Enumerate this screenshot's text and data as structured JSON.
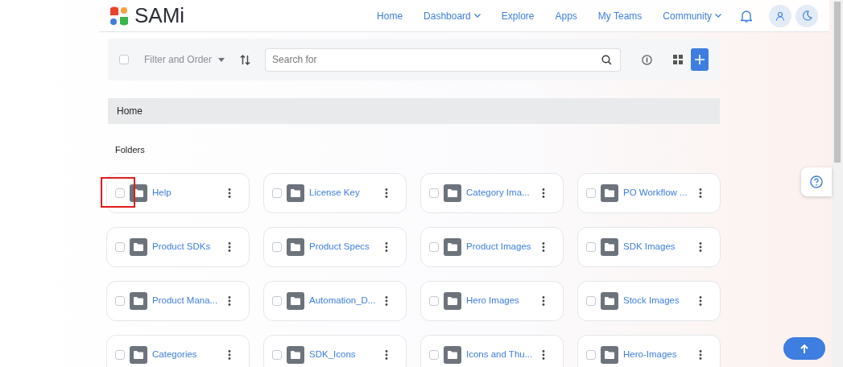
{
  "brand": {
    "name": "SAMi"
  },
  "nav": [
    {
      "label": "Home",
      "dropdown": false
    },
    {
      "label": "Dashboard",
      "dropdown": true
    },
    {
      "label": "Explore",
      "dropdown": false
    },
    {
      "label": "Apps",
      "dropdown": false
    },
    {
      "label": "My Teams",
      "dropdown": false
    },
    {
      "label": "Community",
      "dropdown": true
    }
  ],
  "toolbar": {
    "select_all_checked": false,
    "filter_label": "Filter and Order",
    "search": {
      "placeholder": "Search for"
    }
  },
  "breadcrumb": "Home",
  "section_title": "Folders",
  "folders": [
    {
      "name": "Help",
      "checked": false,
      "highlighted": true
    },
    {
      "name": "License Key",
      "checked": false,
      "highlighted": false
    },
    {
      "name": "Category Ima...",
      "checked": false,
      "highlighted": false
    },
    {
      "name": "PO Workflow ...",
      "checked": false,
      "highlighted": false
    },
    {
      "name": "Product SDKs",
      "checked": false,
      "highlighted": false
    },
    {
      "name": "Product Specs",
      "checked": false,
      "highlighted": false
    },
    {
      "name": "Product Images",
      "checked": false,
      "highlighted": false
    },
    {
      "name": "SDK Images",
      "checked": false,
      "highlighted": false
    },
    {
      "name": "Product Mana...",
      "checked": false,
      "highlighted": false
    },
    {
      "name": "Automation_D...",
      "checked": false,
      "highlighted": false
    },
    {
      "name": "Hero Images",
      "checked": false,
      "highlighted": false
    },
    {
      "name": "Stock Images",
      "checked": false,
      "highlighted": false
    },
    {
      "name": "Categories",
      "checked": false,
      "highlighted": false
    },
    {
      "name": "SDK_Icons",
      "checked": false,
      "highlighted": false
    },
    {
      "name": "Icons and Thu...",
      "checked": false,
      "highlighted": false
    },
    {
      "name": "Hero-Images",
      "checked": false,
      "highlighted": false
    }
  ]
}
